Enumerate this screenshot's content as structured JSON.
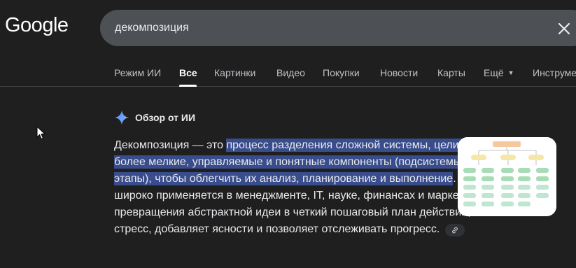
{
  "header": {
    "logo_text": "Google"
  },
  "search": {
    "query": "декомпозиция"
  },
  "tabs": [
    {
      "label": "Режим ИИ",
      "active": false
    },
    {
      "label": "Все",
      "active": true
    },
    {
      "label": "Картинки",
      "active": false
    },
    {
      "label": "Видео",
      "active": false
    },
    {
      "label": "Покупки",
      "active": false
    },
    {
      "label": "Новости",
      "active": false
    },
    {
      "label": "Карты",
      "active": false
    },
    {
      "label": "Ещё",
      "active": false
    },
    {
      "label": "Инструменты",
      "active": false
    }
  ],
  "overview": {
    "title": "Обзор от ИИ",
    "text_before": "Декомпозиция — это ",
    "text_highlight": "процесс разделения сложной системы, цели или задачи на более мелкие, управляемые и понятные компоненты (подсистемы, подцели, этапы), чтобы облегчить их анализ, планирование и выполнение",
    "text_after": ". Этот принцип широко применяется в менеджменте, IT, науке, финансах и маркетинге для превращения абстрактной идеи в четкий пошаговый план действий, что снижает стресс, добавляет ясности и позволяет отслеживать прогресс."
  },
  "colors": {
    "background": "#1f1f1f",
    "search_bg": "#4d5156",
    "highlight": "#394c8b",
    "gemini_blue": "#4f8df7"
  },
  "icons": [
    "close-icon",
    "gemini-sparkle-icon",
    "link-icon",
    "mouse-pointer-icon"
  ]
}
